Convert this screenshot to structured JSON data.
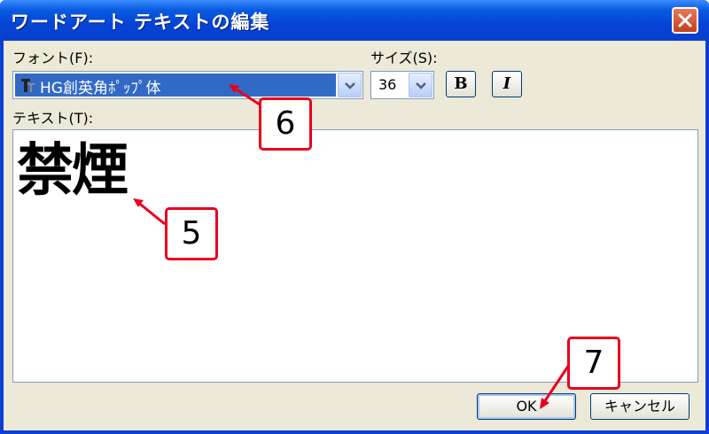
{
  "window": {
    "title": "ワードアート テキストの編集"
  },
  "font": {
    "label": "フォント(F):",
    "value": "HG創英角ﾎﾟｯﾌﾟ体"
  },
  "size": {
    "label": "サイズ(S):",
    "value": "36"
  },
  "format": {
    "bold_label": "B",
    "italic_label": "I"
  },
  "text": {
    "label": "テキスト(T):",
    "value": "禁煙"
  },
  "buttons": {
    "ok": "OK",
    "cancel": "キャンセル"
  },
  "callouts": [
    {
      "number": "6"
    },
    {
      "number": "5"
    },
    {
      "number": "7"
    }
  ],
  "colors": {
    "title_bar": "#0a54e0",
    "dialog_bg": "#ece9d8",
    "selection": "#316ac5",
    "callout_border": "#e8001c",
    "close_button": "#d9532e"
  },
  "icons": {
    "close": "close-icon",
    "dropdown": "chevron-down-icon",
    "font_type": "truetype-font-icon",
    "arrow": "pointer-arrow-icon"
  }
}
